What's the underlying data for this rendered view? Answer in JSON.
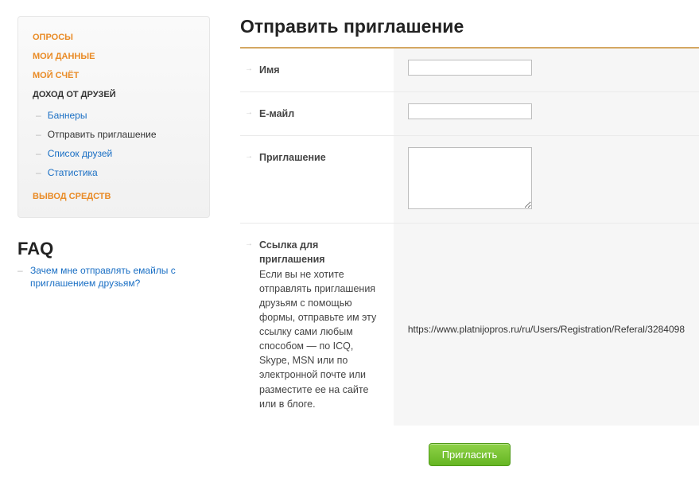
{
  "sidebar": {
    "nav": {
      "surveys": "ОПРОСЫ",
      "my_data": "МОИ ДАННЫЕ",
      "my_account": "МОЙ СЧЁТ",
      "friends_income": "ДОХОД ОТ ДРУЗЕЙ",
      "withdraw": "ВЫВОД СРЕДСТВ"
    },
    "friends_sub": {
      "banners": "Баннеры",
      "send_invite": "Отправить приглашение",
      "friends_list": "Список друзей",
      "statistics": "Статистика"
    }
  },
  "faq": {
    "heading": "FAQ",
    "item1": "Зачем мне отправлять емайлы с приглашением друзьям?"
  },
  "main": {
    "title": "Отправить приглашение",
    "name_label": "Имя",
    "email_label": "Е-майл",
    "invite_label": "Приглашение",
    "link_label_bold": "Ссылка для приглашения",
    "link_label_rest": "Если вы не хотите отправлять приглашения друзьям с помощью формы, отправьте им эту ссылку сами любым способом — по ICQ, Skype, MSN или по электронной почте или разместите ее на сайте или в блоге.",
    "link_value": "https://www.platnijopros.ru/ru/Users/Registration/Referal/3284098",
    "submit_label": "Пригласить",
    "name_value": "",
    "email_value": "",
    "invite_value": ""
  }
}
